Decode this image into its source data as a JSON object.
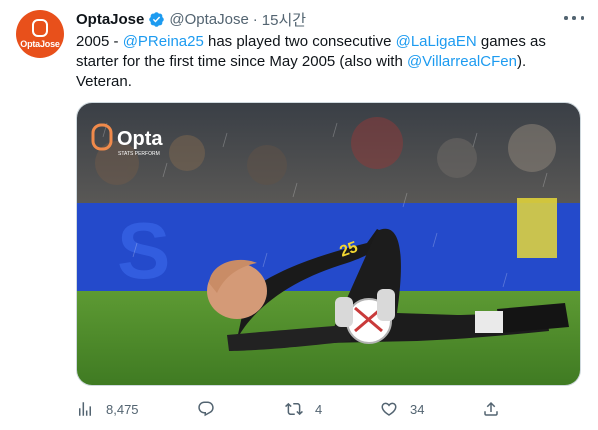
{
  "author": {
    "display_name": "OptaJose",
    "handle": "@OptaJose",
    "time": "15시간",
    "avatar_text": "OptaJose"
  },
  "tweet": {
    "prefix": "2005 - ",
    "mention1": "@PReina25",
    "mid1": " has played two consecutive ",
    "mention2": "@LaLigaEN",
    "mid2": " games as starter for the first time since May 2005 (also with ",
    "mention3": "@VillarrealCFen",
    "suffix": "). Veteran."
  },
  "media": {
    "watermark_brand": "Opta",
    "watermark_sub": "STATS PERFORM",
    "jersey_number": "25"
  },
  "actions": {
    "views": "8,475",
    "reply": "",
    "retweets": "4",
    "likes": "34",
    "share": ""
  },
  "colors": {
    "link": "#1d9bf0",
    "muted": "#536471",
    "brand": "#e8501b",
    "pitch": "#4f8a2a"
  }
}
